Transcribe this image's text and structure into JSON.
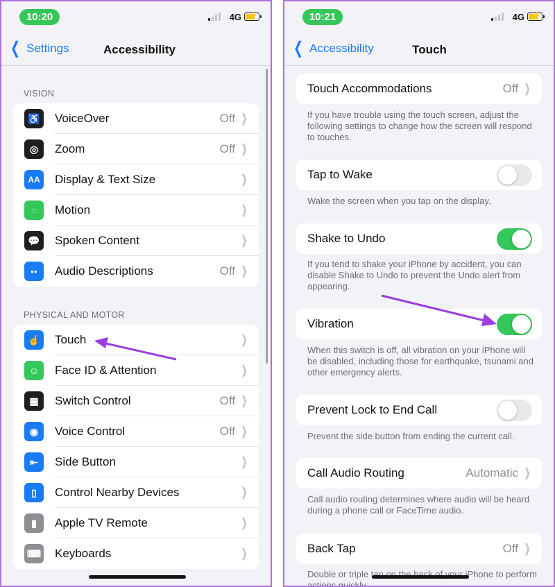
{
  "left": {
    "status": {
      "time": "10:20",
      "network": "4G"
    },
    "nav": {
      "back_label": "Settings",
      "title": "Accessibility"
    },
    "vision": {
      "header": "VISION",
      "items": [
        {
          "label": "VoiceOver",
          "value": "Off",
          "icon": "voiceover-icon",
          "color": "#1f1f1f"
        },
        {
          "label": "Zoom",
          "value": "Off",
          "icon": "zoom-icon",
          "color": "#1f1f1f"
        },
        {
          "label": "Display & Text Size",
          "value": "",
          "icon": "display-text-icon",
          "color": "#1a7cf5"
        },
        {
          "label": "Motion",
          "value": "",
          "icon": "motion-icon",
          "color": "#34c759"
        },
        {
          "label": "Spoken Content",
          "value": "",
          "icon": "spoken-content-icon",
          "color": "#1f1f1f"
        },
        {
          "label": "Audio Descriptions",
          "value": "Off",
          "icon": "audio-descriptions-icon",
          "color": "#1a7cf5"
        }
      ]
    },
    "physical": {
      "header": "PHYSICAL AND MOTOR",
      "items": [
        {
          "label": "Touch",
          "value": "",
          "icon": "touch-icon",
          "color": "#1a7cf5"
        },
        {
          "label": "Face ID & Attention",
          "value": "",
          "icon": "face-id-icon",
          "color": "#34c759"
        },
        {
          "label": "Switch Control",
          "value": "Off",
          "icon": "switch-control-icon",
          "color": "#1f1f1f"
        },
        {
          "label": "Voice Control",
          "value": "Off",
          "icon": "voice-control-icon",
          "color": "#1a7cf5"
        },
        {
          "label": "Side Button",
          "value": "",
          "icon": "side-button-icon",
          "color": "#1a7cf5"
        },
        {
          "label": "Control Nearby Devices",
          "value": "",
          "icon": "nearby-devices-icon",
          "color": "#1a7cf5"
        },
        {
          "label": "Apple TV Remote",
          "value": "",
          "icon": "tv-remote-icon",
          "color": "#8e8e93"
        },
        {
          "label": "Keyboards",
          "value": "",
          "icon": "keyboard-icon",
          "color": "#8e8e93"
        }
      ]
    }
  },
  "right": {
    "status": {
      "time": "10:21",
      "network": "4G"
    },
    "nav": {
      "back_label": "Accessibility",
      "title": "Touch"
    },
    "touch_accommodations": {
      "label": "Touch Accommodations",
      "value": "Off",
      "footer": "If you have trouble using the touch screen, adjust the following settings to change how the screen will respond to touches."
    },
    "tap_to_wake": {
      "label": "Tap to Wake",
      "state": "off",
      "footer": "Wake the screen when you tap on the display."
    },
    "shake_to_undo": {
      "label": "Shake to Undo",
      "state": "on",
      "footer": "If you tend to shake your iPhone by accident, you can disable Shake to Undo to prevent the Undo alert from appearing."
    },
    "vibration": {
      "label": "Vibration",
      "state": "on",
      "footer": "When this switch is off, all vibration on your iPhone will be disabled, including those for earthquake, tsunami and other emergency alerts."
    },
    "prevent_lock": {
      "label": "Prevent Lock to End Call",
      "state": "off",
      "footer": "Prevent the side button from ending the current call."
    },
    "call_audio_routing": {
      "label": "Call Audio Routing",
      "value": "Automatic",
      "footer": "Call audio routing determines where audio will be heard during a phone call or FaceTime audio."
    },
    "back_tap": {
      "label": "Back Tap",
      "value": "Off",
      "footer": "Double or triple tap on the back of your iPhone to perform actions quickly."
    }
  },
  "colors": {
    "accent": "#1a7cf5",
    "toggle_on": "#34c759",
    "annotation": "#9b3de0"
  }
}
